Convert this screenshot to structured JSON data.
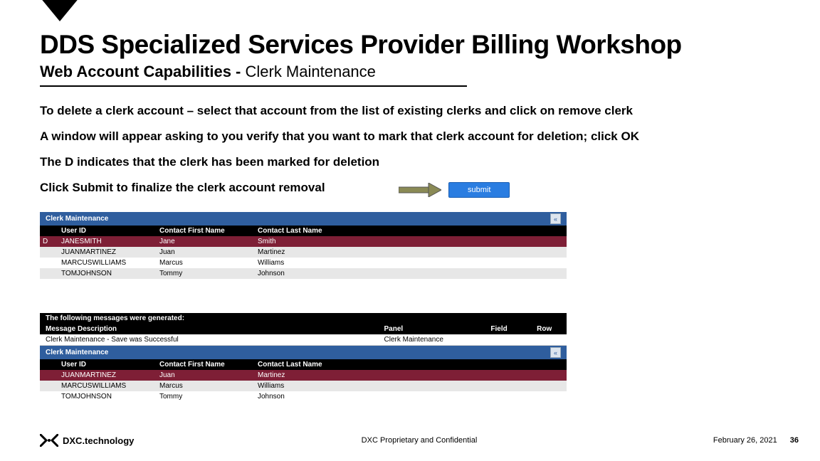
{
  "title": "DDS Specialized Services Provider Billing Workshop",
  "subtitle_bold": "Web Account Capabilities - ",
  "subtitle_rest": "Clerk Maintenance",
  "body": {
    "p1": "To delete a clerk account – select that account from the list of existing clerks and click on remove clerk",
    "p2": "A window will appear asking to you verify that you want to mark that clerk account for deletion; click OK",
    "p3": "The D indicates that the clerk has been marked for deletion",
    "p4": "Click Submit to finalize the clerk account removal"
  },
  "submit_label": "submit",
  "panel_title": "Clerk Maintenance",
  "collapse_glyph": "«",
  "columns": {
    "c2": "User ID",
    "c3": "Contact First Name",
    "c4": "Contact Last Name"
  },
  "rows1": [
    {
      "flag": "D",
      "user": "JANESMITH",
      "first": "Jane",
      "last": "Smith",
      "style": "maroon"
    },
    {
      "flag": "",
      "user": "JUANMARTINEZ",
      "first": "Juan",
      "last": "Martinez",
      "style": "grey"
    },
    {
      "flag": "",
      "user": "MARCUSWILLIAMS",
      "first": "Marcus",
      "last": "Williams",
      "style": "white"
    },
    {
      "flag": "",
      "user": "TOMJOHNSON",
      "first": "Tommy",
      "last": "Johnson",
      "style": "grey"
    }
  ],
  "msg_intro": "The following messages were generated:",
  "msg_cols": {
    "m1": "Message Description",
    "m2": "Panel",
    "m3": "Field",
    "m4": "Row"
  },
  "msg_row": {
    "m1": "Clerk Maintenance - Save was Successful",
    "m2": "Clerk Maintenance",
    "m3": "",
    "m4": ""
  },
  "rows2": [
    {
      "flag": "",
      "user": "JUANMARTINEZ",
      "first": "Juan",
      "last": "Martinez",
      "style": "maroon"
    },
    {
      "flag": "",
      "user": "MARCUSWILLIAMS",
      "first": "Marcus",
      "last": "Williams",
      "style": "grey"
    },
    {
      "flag": "",
      "user": "TOMJOHNSON",
      "first": "Tommy",
      "last": "Johnson",
      "style": "white"
    }
  ],
  "footer": {
    "brand": "DXC.technology",
    "center": "DXC Proprietary and Confidential",
    "date": "February 26, 2021",
    "page": "36"
  }
}
